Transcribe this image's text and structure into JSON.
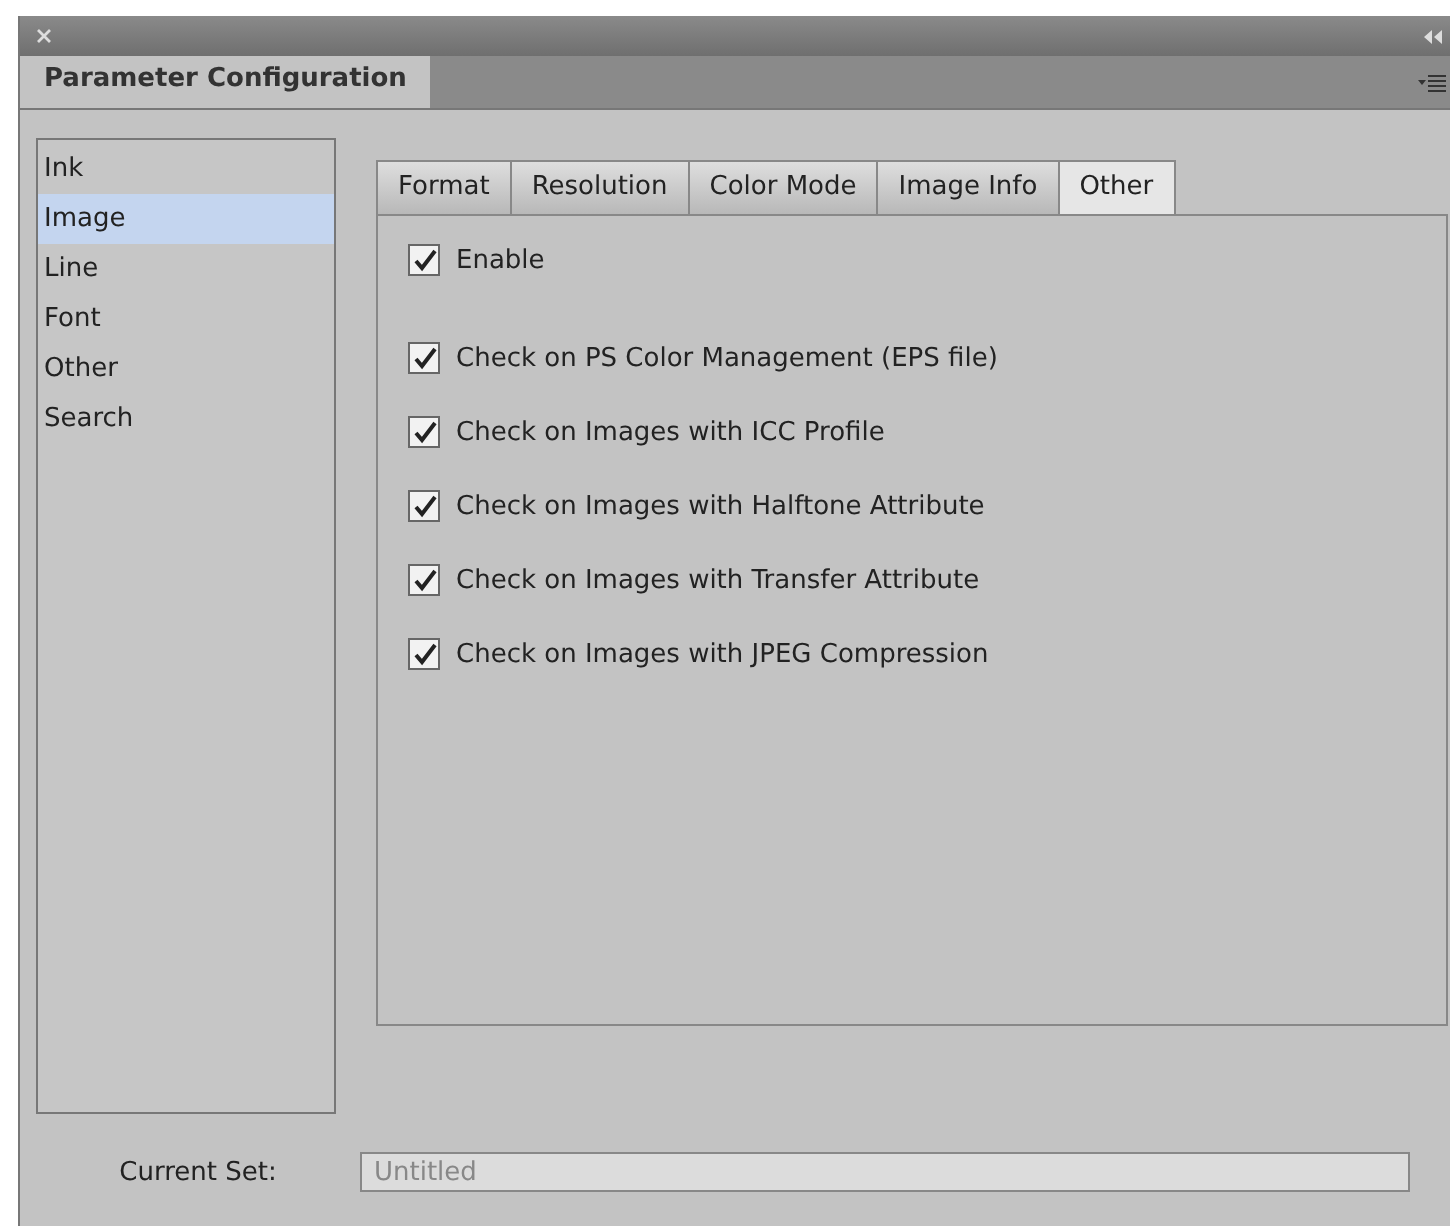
{
  "window": {
    "title": "Parameter Configuration"
  },
  "sidebar": {
    "items": [
      {
        "label": "Ink",
        "selected": false
      },
      {
        "label": "Image",
        "selected": true
      },
      {
        "label": "Line",
        "selected": false
      },
      {
        "label": "Font",
        "selected": false
      },
      {
        "label": "Other",
        "selected": false
      },
      {
        "label": "Search",
        "selected": false
      }
    ]
  },
  "tabs": [
    {
      "label": "Format",
      "selected": false
    },
    {
      "label": "Resolution",
      "selected": false
    },
    {
      "label": "Color Mode",
      "selected": false
    },
    {
      "label": "Image Info",
      "selected": false
    },
    {
      "label": "Other",
      "selected": true
    }
  ],
  "enable": {
    "label": "Enable",
    "checked": true
  },
  "options": [
    {
      "label": "Check on PS Color Management (EPS file)",
      "checked": true
    },
    {
      "label": "Check on Images with ICC Profile",
      "checked": true
    },
    {
      "label": "Check on Images with Halftone Attribute",
      "checked": true
    },
    {
      "label": "Check on Images with Transfer Attribute",
      "checked": true
    },
    {
      "label": "Check on Images with JPEG Compression",
      "checked": true
    }
  ],
  "current_set": {
    "label": "Current Set:",
    "value": "Untitled"
  }
}
